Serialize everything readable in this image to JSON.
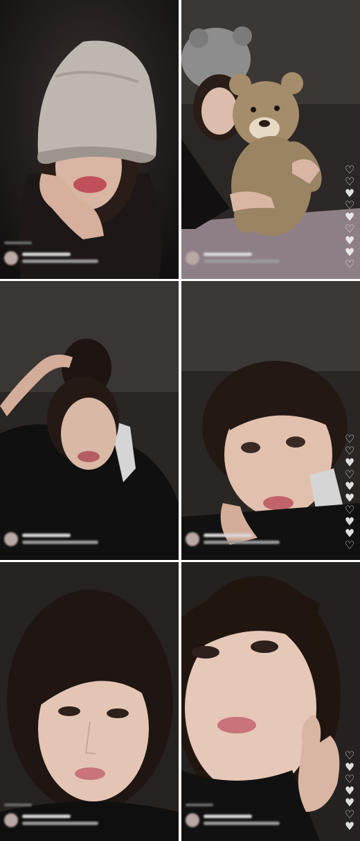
{
  "panels": [
    {
      "id": 1,
      "subject": "woman-in-bucket-hat",
      "has_hearts": false
    },
    {
      "id": 2,
      "subject": "woman-with-teddy-bear",
      "has_hearts": true
    },
    {
      "id": 3,
      "subject": "woman-hand-in-hair",
      "has_hearts": false
    },
    {
      "id": 4,
      "subject": "woman-closeup-lying",
      "has_hearts": true
    },
    {
      "id": 5,
      "subject": "woman-closeup-face",
      "has_hearts": false
    },
    {
      "id": 6,
      "subject": "woman-closeup-waving",
      "has_hearts": true
    }
  ],
  "overlay_icons": {
    "heart": "heart-icon",
    "avatar": "avatar"
  },
  "colors": {
    "background": "#1a1a1a",
    "gutter": "#ffffff",
    "heart": "#f4f4f4",
    "skin": "#e9c9b6",
    "hair": "#2a1d17"
  }
}
